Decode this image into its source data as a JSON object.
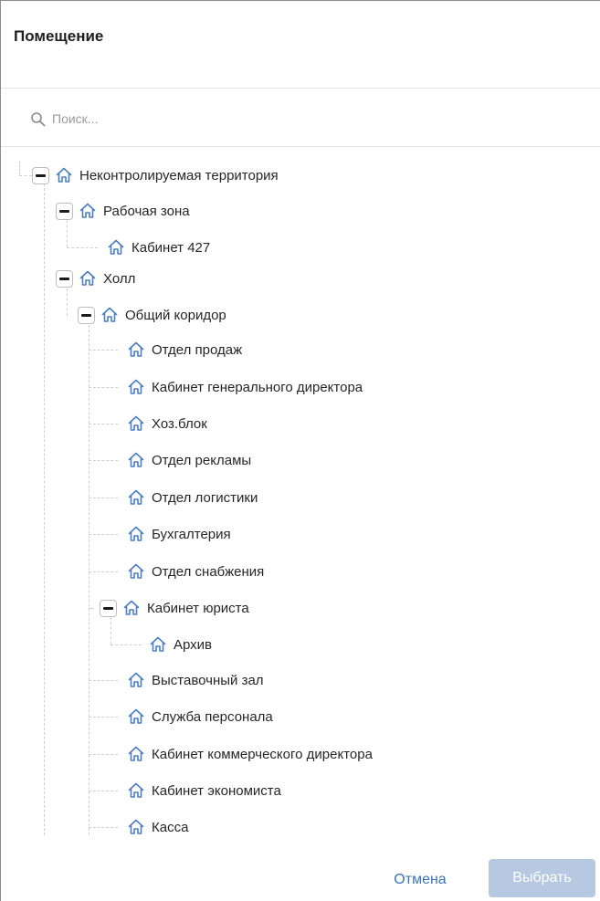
{
  "dialog": {
    "title": "Помещение",
    "search": {
      "placeholder": "Поиск...",
      "value": ""
    },
    "tree": [
      {
        "label": "Неконтролируемая территория",
        "icon": "home-icon",
        "expanded": true
      },
      {
        "label": "Рабочая зона",
        "icon": "home-icon",
        "expanded": true
      },
      {
        "label": "Кабинет 427",
        "icon": "home-icon"
      },
      {
        "label": "Холл",
        "icon": "home-icon",
        "expanded": true
      },
      {
        "label": "Общий коридор",
        "icon": "home-icon",
        "expanded": true
      },
      {
        "label": "Отдел продаж",
        "icon": "home-icon"
      },
      {
        "label": "Кабинет генерального директора",
        "icon": "home-icon"
      },
      {
        "label": "Хоз.блок",
        "icon": "home-icon"
      },
      {
        "label": "Отдел рекламы",
        "icon": "home-icon"
      },
      {
        "label": "Отдел логистики",
        "icon": "home-icon"
      },
      {
        "label": "Бухгалтерия",
        "icon": "home-icon"
      },
      {
        "label": "Отдел снабжения",
        "icon": "home-icon"
      },
      {
        "label": "Кабинет юриста",
        "icon": "home-icon",
        "expanded": true
      },
      {
        "label": "Архив",
        "icon": "home-icon"
      },
      {
        "label": "Выставочный зал",
        "icon": "home-icon"
      },
      {
        "label": "Служба персонала",
        "icon": "home-icon"
      },
      {
        "label": "Кабинет коммерческого директора",
        "icon": "home-icon"
      },
      {
        "label": "Кабинет экономиста",
        "icon": "home-icon"
      },
      {
        "label": "Касса",
        "icon": "home-icon"
      }
    ],
    "buttons": {
      "cancel_label": "Отмена",
      "select_label": "Выбрать"
    }
  },
  "colors": {
    "accent": "#3a73b8",
    "icon": "#4a7fc1",
    "disabled_button": "#b7c9e1"
  }
}
